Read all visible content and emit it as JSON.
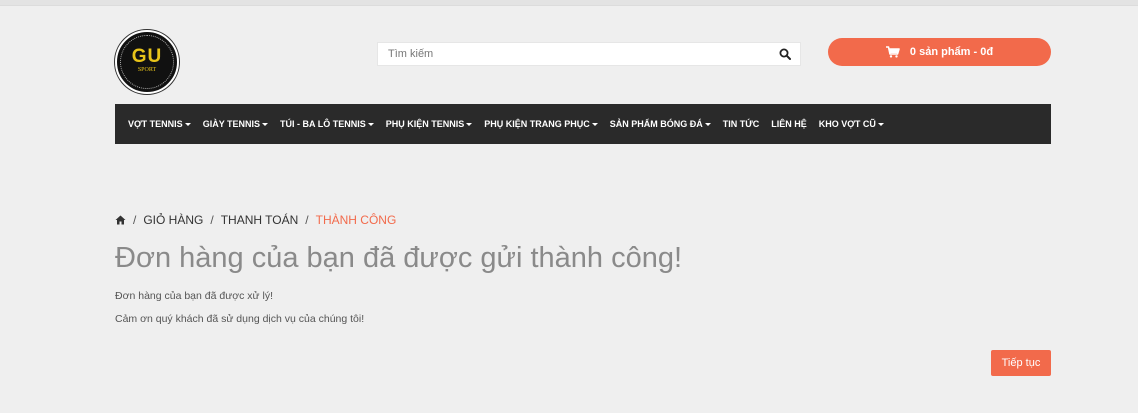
{
  "header": {
    "logo": {
      "brand_text": "GU",
      "sub_text": "SPORT"
    },
    "search": {
      "placeholder": "Tìm kiếm",
      "value": "",
      "icon": "search-icon"
    },
    "cart": {
      "label": "0 sản phẩm - 0đ",
      "icon": "shopping-cart-icon"
    }
  },
  "nav": {
    "items": [
      {
        "label": "VỢT TENNIS",
        "dropdown": true
      },
      {
        "label": "GIÀY TENNIS",
        "dropdown": true
      },
      {
        "label": "TÚI - BA LÔ TENNIS",
        "dropdown": true
      },
      {
        "label": "PHỤ KIỆN TENNIS",
        "dropdown": true
      },
      {
        "label": "PHỤ KIỆN TRANG PHỤC",
        "dropdown": true
      },
      {
        "label": "SẢN PHẨM BÓNG ĐÁ",
        "dropdown": true
      },
      {
        "label": "TIN TỨC",
        "dropdown": false
      },
      {
        "label": "LIÊN HỆ",
        "dropdown": false
      },
      {
        "label": "KHO VỢT CŨ",
        "dropdown": true
      }
    ]
  },
  "breadcrumb": {
    "home_icon": "home-icon",
    "items": [
      "GIỎ HÀNG",
      "THANH TOÁN",
      "THÀNH CÔNG"
    ],
    "separator": "/"
  },
  "content": {
    "title": "Đơn hàng của bạn đã được gửi thành công!",
    "message_1": "Đơn hàng của bạn đã được xử lý!",
    "message_2": "Cảm ơn quý khách đã sử dụng dịch vụ của chúng tôi!",
    "continue_label": "Tiếp tục"
  },
  "colors": {
    "accent": "#f26a4b",
    "nav_bg": "#2a2a2a",
    "page_bg": "#efefef"
  }
}
